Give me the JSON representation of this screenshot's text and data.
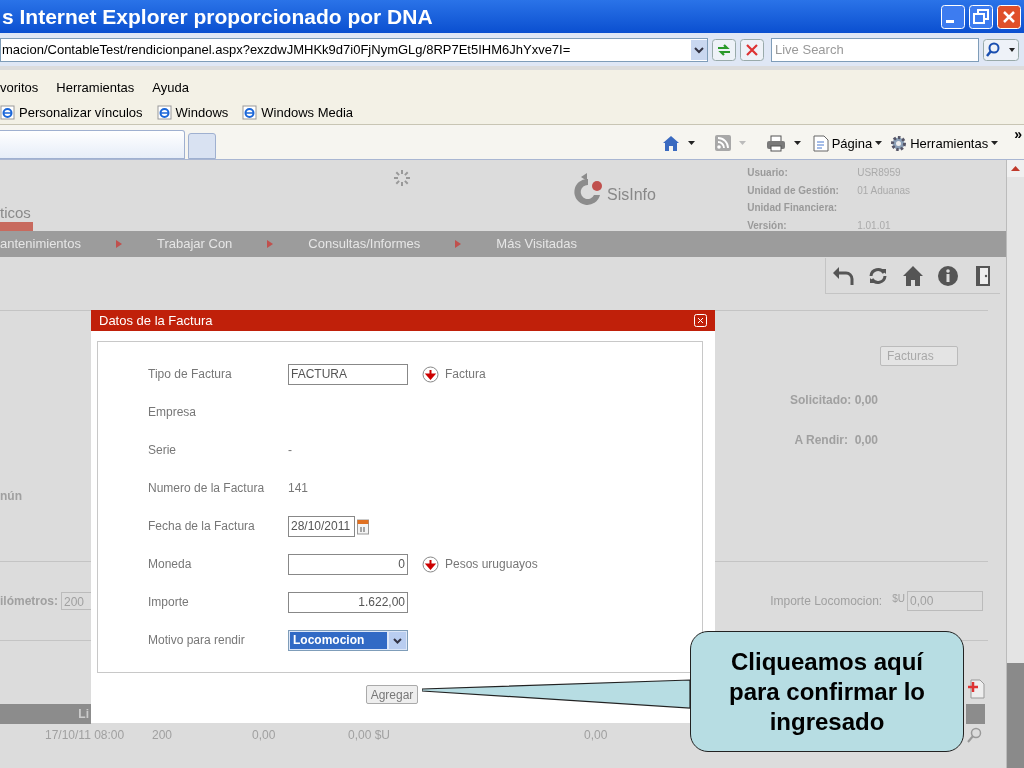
{
  "window": {
    "title": "s Internet Explorer proporcionado por DNA"
  },
  "address_bar": {
    "url": "macion/ContableTest/rendicionpanel.aspx?exzdwJMHKk9d7i0FjNymGLg/8RP7Et5IHM6JhYxve7I=",
    "search_placeholder": "Live Search"
  },
  "menu_bar": [
    "voritos",
    "Herramientas",
    "Ayuda"
  ],
  "links_bar": [
    "Personalizar vínculos",
    "Windows",
    "Windows Media"
  ],
  "command_bar": {
    "page_label": "Página",
    "tools_label": "Herramientas",
    "more": "»"
  },
  "page": {
    "section_tab": "ticos",
    "brand": "SisInfo",
    "user_info": [
      {
        "label": "Usuario:",
        "value": "USR8959"
      },
      {
        "label": "Unidad de Gestión:",
        "value": "01 Aduanas"
      },
      {
        "label": "Unidad Financiera:"
      },
      {
        "label": "Versión:",
        "value": "1.01.01"
      }
    ],
    "nav": [
      "antenimientos",
      "Trabajar Con",
      "Consultas/Informes",
      "Más Visitadas"
    ],
    "left_label": "nún",
    "km_label": "ilómetros:",
    "km_value": "200",
    "facturas_button": "Facturas",
    "solicitado": "Solicitado: 0,00",
    "a_rendir": "A Rendir:  0,00",
    "importe_label": "Importe Locomocion:",
    "importe_currency": "$U",
    "importe_value": "0,00",
    "table_header": "Li",
    "table_row": [
      "17/10/11 08:00",
      "200",
      "0,00",
      "0,00 $U",
      "0,00"
    ]
  },
  "dialog": {
    "title": "Datos de la Factura",
    "button": "Agregar",
    "fields": [
      {
        "label": "Tipo de Factura",
        "kind": "text-input",
        "value": "FACTURA",
        "description": "Factura"
      },
      {
        "label": "Empresa",
        "kind": "text"
      },
      {
        "label": "Serie",
        "kind": "text",
        "value": "-"
      },
      {
        "label": "Numero de la Factura",
        "kind": "text",
        "value": "141"
      },
      {
        "label": "Fecha de la Factura",
        "kind": "date",
        "value": "28/10/2011"
      },
      {
        "label": "Moneda",
        "kind": "number-input",
        "value": "0",
        "description": "Pesos uruguayos"
      },
      {
        "label": "Importe",
        "kind": "number-input",
        "value": "1.622,00"
      },
      {
        "label": "Motivo para rendir",
        "kind": "select",
        "value": "Locomocion"
      }
    ]
  },
  "callout": {
    "text": "Cliqueamos aquí para confirmar lo ingresado"
  }
}
